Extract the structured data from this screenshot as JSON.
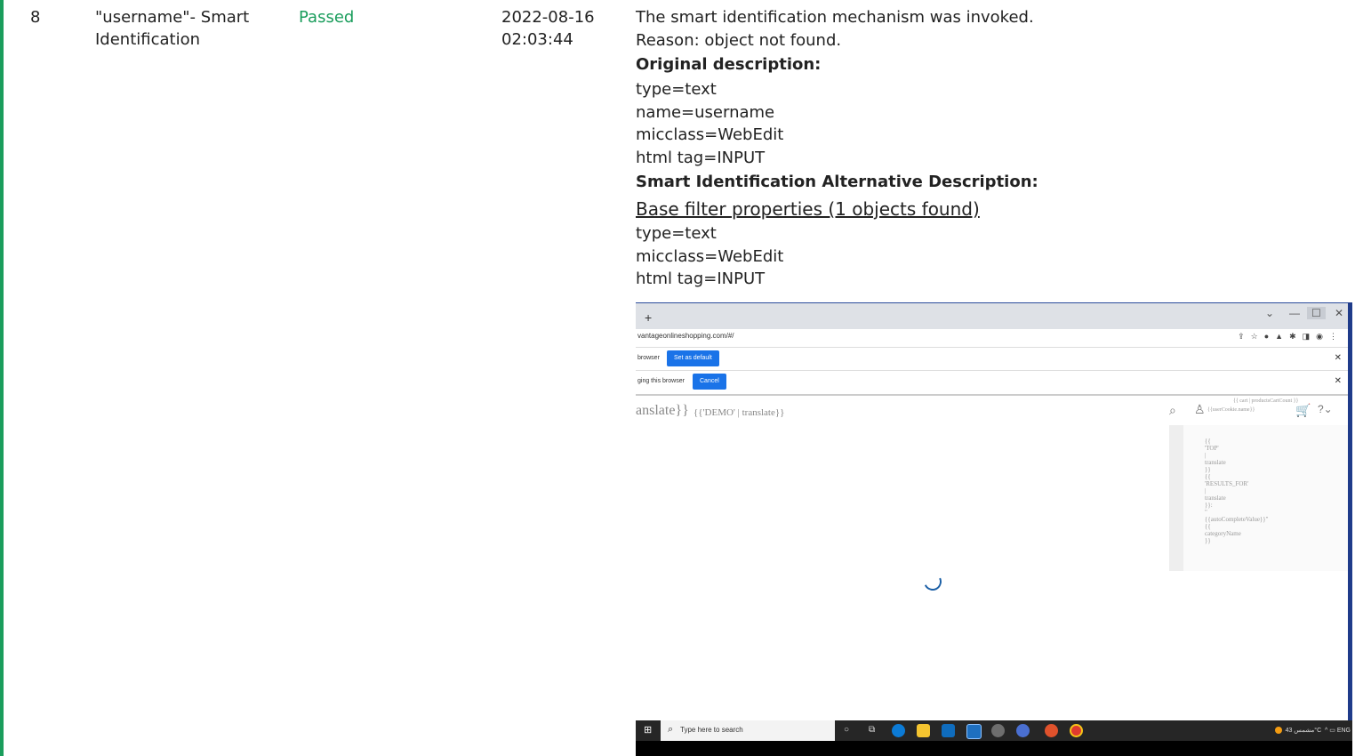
{
  "row": {
    "number": "8",
    "name_line1": "\"username\"- Smart",
    "name_line2": "Identification",
    "status": "Passed",
    "date": "2022-08-16",
    "time": "02:03:44",
    "details": {
      "line1": "The smart identification mechanism was invoked.",
      "line2": "Reason: object not found.",
      "original_heading": "Original description:",
      "original": [
        "type=text",
        "name=username",
        "micclass=WebEdit",
        "html tag=INPUT"
      ],
      "alt_heading": "Smart Identification Alternative Description:",
      "base_filter_link": "Base filter properties (1 objects found)",
      "alt": [
        "type=text",
        "micclass=WebEdit",
        "html tag=INPUT"
      ]
    }
  },
  "screenshot": {
    "new_tab": "+",
    "url": "vantageonlineshopping.com/#/",
    "infobar1_text": "browser",
    "infobar1_button": "Set as default",
    "infobar2_text": "ging this browser",
    "infobar2_button": "Cancel",
    "site_translate": "anslate}}",
    "site_demo": "{{'DEMO' | translate}}",
    "cart_count_text": "{{ cart | productsCartCount }}",
    "user_text": "{{userCookie.name}}",
    "side_text": "{{\n'TOP'\n|\ntranslate\n}}\n{{\n'RESULTS_FOR'\n|\ntranslate\n}}:\n\"\n{{autoCompleteValue}}\"\n{{\ncategoryName\n}}",
    "taskbar_search": "Type here to search",
    "tray_text": "مشمس 43°C",
    "tray_lang": "ENG",
    "colors": {
      "accent_green": "#1a9d5c",
      "link_blue": "#1a73e8",
      "taskbar": "#262626"
    }
  }
}
